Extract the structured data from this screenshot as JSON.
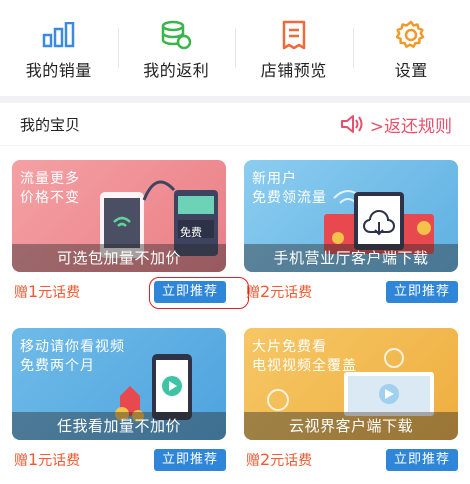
{
  "menu": [
    {
      "label": "我的销量",
      "icon": "bar-chart-icon"
    },
    {
      "label": "我的返利",
      "icon": "coins-stack-icon"
    },
    {
      "label": "店铺预览",
      "icon": "document-icon"
    },
    {
      "label": "设置",
      "icon": "gear-icon"
    }
  ],
  "section": {
    "title": "我的宝贝",
    "rules_label": ">返还规则",
    "rules_icon": "speaker-icon"
  },
  "cards": [
    {
      "line1": "流量更多",
      "line2": "价格不变",
      "caption": "可选包加量不加价",
      "gift_prefix": "赠",
      "gift_amount": "1",
      "gift_unit": "元话费",
      "button": "立即推荐",
      "theme": "#f08d92",
      "extra": "免费"
    },
    {
      "line1": "新用户",
      "line2": "免费领流量",
      "caption": "手机营业厅客户端下载",
      "gift_prefix": "赠",
      "gift_amount": "2",
      "gift_unit": "元话费",
      "button": "立即推荐",
      "theme": "#6fb9e6",
      "extra": ""
    },
    {
      "line1": "移动请你看视频",
      "line2": "免费两个月",
      "caption": "任我看加量不加价",
      "gift_prefix": "赠",
      "gift_amount": "1",
      "gift_unit": "元话费",
      "button": "立即推荐",
      "theme": "#5aaee3",
      "extra": ""
    },
    {
      "line1": "大片免费看",
      "line2": "电视视频全覆盖",
      "caption": "云视界客户端下载",
      "gift_prefix": "赠",
      "gift_amount": "2",
      "gift_unit": "元话费",
      "button": "立即推荐",
      "theme": "#f2ba4f",
      "extra": ""
    }
  ],
  "colors": {
    "accent": "#2f86d8",
    "rules": "#e8506b",
    "gift": "#ef5a33"
  }
}
